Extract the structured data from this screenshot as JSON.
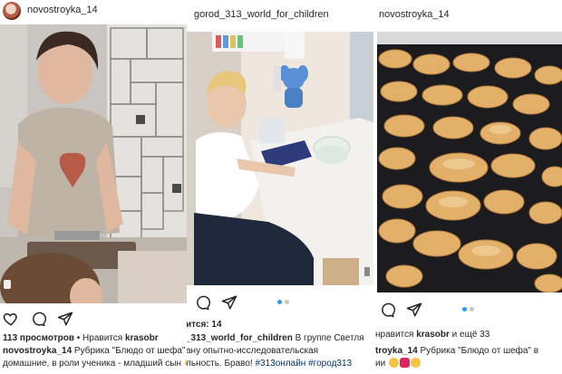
{
  "post1": {
    "username": "novostroyka_14",
    "views_count": "113 просмотров",
    "liked_by_prefix": " • Нравится ",
    "liked_by_user": "krasobr",
    "caption_user": "novostroyka_14",
    "caption_line1": " Рубрика \"Блюдо от шефа\" (усл",
    "caption_line2": "домашние, в роли ученика - младший сын"
  },
  "post2": {
    "username": "gorod_313_world_for_children",
    "likes_line": "ится: 14",
    "caption_user": "_313_world_for_children",
    "caption_line1_rest": " В группе Светля",
    "caption_line2": "ану опытно-исследовательская",
    "caption_line3_prefix": "льность. Браво! ",
    "hashtag1": "#313онлайн",
    "hashtag2": "#город313"
  },
  "post3": {
    "username": "novostroyka_14",
    "liked_prefix": "нравится ",
    "liked_user": "krasobr",
    "liked_suffix": " и ещё 33",
    "caption_user": "troyka_14",
    "caption_line1_rest": " Рубрика \"Блюдо от шефа\" в",
    "caption_line2": "ии"
  },
  "colors": {
    "accent_blue": "#3897f0",
    "text": "#262626",
    "hashtag": "#003569"
  },
  "icons": [
    "heart-icon",
    "comment-icon",
    "share-icon"
  ]
}
